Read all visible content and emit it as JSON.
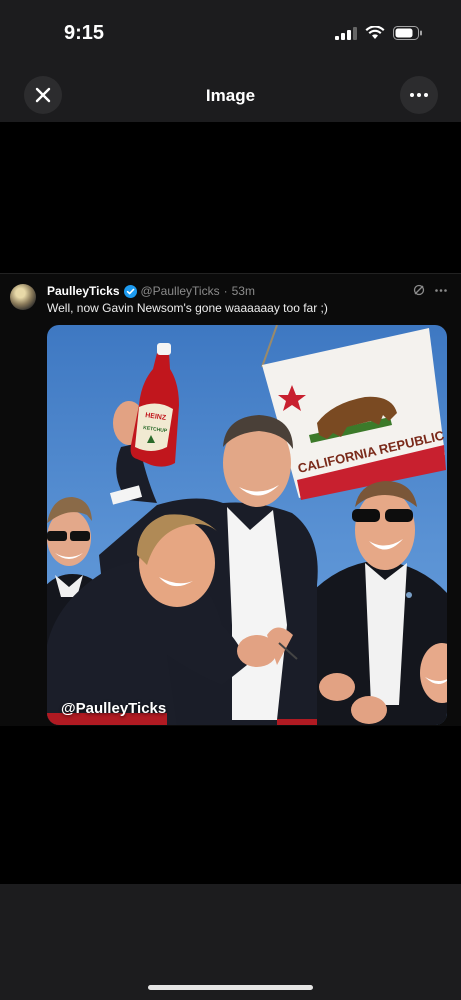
{
  "status_bar": {
    "time": "9:15"
  },
  "nav": {
    "title": "Image",
    "close_icon": "close-icon",
    "more_icon": "more-horizontal-icon"
  },
  "tweet": {
    "author_name": "PaulleyTicks",
    "handle": "@PaulleyTicks",
    "separator": "·",
    "age": "53m",
    "text": "Well, now Gavin Newsom's gone waaaaaay too far ;)",
    "verified_color": "#1d9bf0"
  },
  "media": {
    "flag_text": "CALIFORNIA REPUBLIC",
    "watermark": "@PaulleyTicks",
    "bottle_brand": "HEINZ",
    "bottle_label": "KETCHUP"
  }
}
